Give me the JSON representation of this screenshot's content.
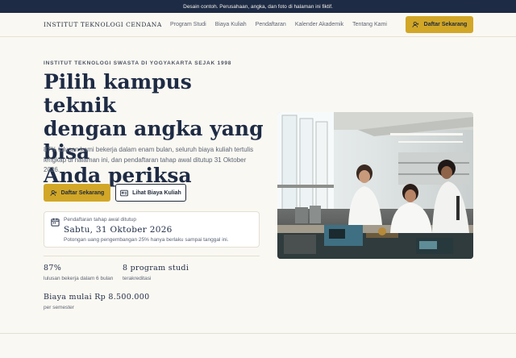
{
  "banner": {
    "text": "Desain contoh. Perusahaan, angka, dan foto di halaman ini fiktif."
  },
  "nav": {
    "brand": "INSTITUT TEKNOLOGI CENDANA",
    "items": [
      "Program Studi",
      "Biaya Kuliah",
      "Pendaftaran",
      "Kalender Akademik",
      "Tentang Kami"
    ],
    "cta_label": "Daftar Sekarang"
  },
  "hero": {
    "eyebrow": "INSTITUT TEKNOLOGI SWASTA DI YOGYAKARTA SEJAK 1998",
    "headline_lines": [
      "Pilih kampus teknik",
      "dengan angka yang bisa",
      "Anda periksa"
    ],
    "lede": "87% lulusan kami bekerja dalam enam bulan, seluruh biaya kuliah tertulis lengkap di halaman ini, dan pendaftaran tahap awal ditutup 31 Oktober 2026.",
    "primary_label": "Daftar Sekarang",
    "secondary_label": "Lihat Biaya Kuliah"
  },
  "deadline": {
    "label": "Pendaftaran tahap awal ditutup",
    "date": "Sabtu, 31 Oktober 2026",
    "note": "Potongan uang pengembangan 25% hanya berlaku sampai tanggal ini."
  },
  "stats": [
    {
      "value": "87%",
      "label": "lulusan bekerja dalam 6 bulan"
    },
    {
      "value": "8 program studi",
      "label": "terakreditasi"
    },
    {
      "value": "Biaya mulai Rp 8.500.000",
      "label": "per semester"
    }
  ],
  "colors": {
    "navy": "#1e2b45",
    "gold": "#d2a727",
    "cream": "#faf8f2"
  },
  "icons": {
    "nav_cta": "user-plus-icon",
    "primary": "user-plus-icon",
    "secondary": "id-card-icon",
    "deadline": "calendar-icon"
  }
}
